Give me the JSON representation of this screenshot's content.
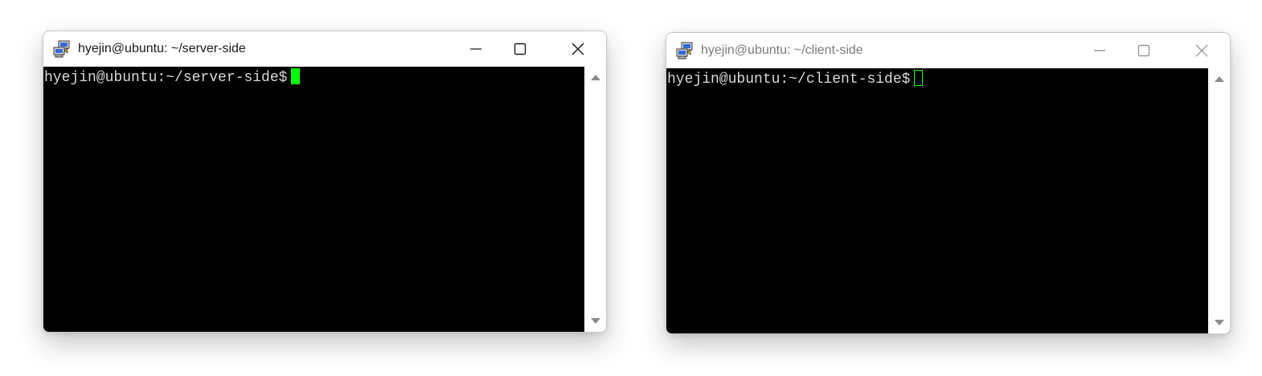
{
  "windows": [
    {
      "title": "hyejin@ubuntu: ~/server-side",
      "prompt": "hyejin@ubuntu:~/server-side$",
      "active": true,
      "icon": "putty-computers-icon",
      "cursor_style": "block",
      "cursor_color": "#00ff00"
    },
    {
      "title": "hyejin@ubuntu: ~/client-side",
      "prompt": "hyejin@ubuntu:~/client-side$",
      "active": false,
      "icon": "putty-computers-icon",
      "cursor_style": "outline",
      "cursor_color": "#00ff00"
    }
  ],
  "colors": {
    "terminal_background": "#000000",
    "terminal_text": "#d9d9d9",
    "cursor": "#00ff00"
  }
}
